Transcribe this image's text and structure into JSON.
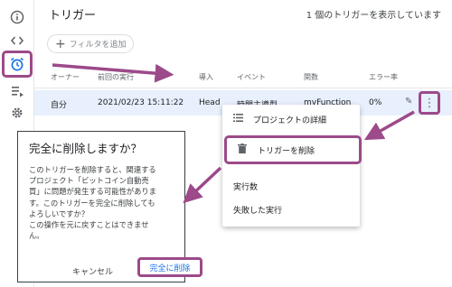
{
  "header": {
    "title": "トリガー",
    "count_text": "1 個のトリガーを表示しています"
  },
  "filter": {
    "label": "フィルタを追加"
  },
  "table": {
    "columns": [
      "オーナー",
      "前回の実行",
      "導入",
      "イベント",
      "関数",
      "エラー率"
    ],
    "rows": [
      {
        "owner": "自分",
        "last_run": "2021/02/23 15:11:22",
        "deployment": "Head",
        "event": "時間主導型",
        "function": "myFunction",
        "error_rate": "0%"
      }
    ]
  },
  "menu": {
    "items": [
      {
        "label": "プロジェクトの詳細",
        "icon": "list-icon"
      },
      {
        "label": "トリガーを削除",
        "icon": "trash-icon"
      },
      {
        "label": "実行数"
      },
      {
        "label": "失敗した実行"
      }
    ]
  },
  "dialog": {
    "title": "完全に削除しますか？",
    "body": "このトリガーを削除すると、関連する\nプロジェクト「ビットコイン自動売\n買」に問題が発生する可能性がありま\nす。このトリガーを完全に削除しても\nよろしいですか？\nこの操作を元に戻すことはできませ\nん。",
    "cancel_label": "キャンセル",
    "confirm_label": "完全に削除"
  },
  "icons": {
    "row_more": "⋮",
    "row_edit": "✎"
  },
  "colors": {
    "highlight": "#9c4a8a",
    "accent": "#1a73e8",
    "row_selected": "#e8f0fe"
  }
}
